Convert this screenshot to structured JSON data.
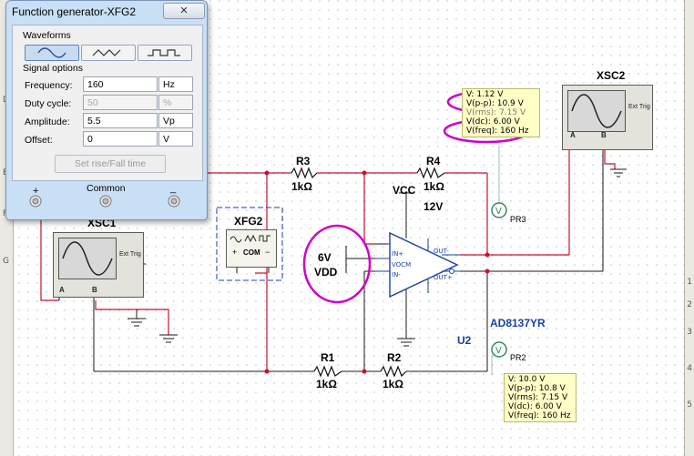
{
  "dialog": {
    "title": "Function generator-XFG2",
    "close_label": "✕",
    "waveforms_label": "Waveforms",
    "waveforms": [
      "sine-wave-icon",
      "triangle-wave-icon",
      "square-wave-icon"
    ],
    "signal_options_label": "Signal options",
    "fields": [
      {
        "label": "Frequency:",
        "value": "160",
        "unit": "Hz",
        "disabled": false
      },
      {
        "label": "Duty cycle:",
        "value": "50",
        "unit": "%",
        "disabled": true
      },
      {
        "label": "Amplitude:",
        "value": "5.5",
        "unit": "Vp",
        "disabled": false
      },
      {
        "label": "Offset:",
        "value": "0",
        "unit": "V",
        "disabled": false
      }
    ],
    "rise_fall_button": "Set rise/Fall time",
    "terminals": {
      "plus": "+",
      "common": "Common",
      "minus": "_"
    }
  },
  "rulers": {
    "left": [
      "D",
      "E",
      "F",
      "G"
    ],
    "right": [
      "1",
      "2",
      "3",
      "4",
      "5"
    ]
  },
  "schematic": {
    "r3": {
      "name": "R3",
      "value": "1kΩ"
    },
    "r4": {
      "name": "R4",
      "value": "1kΩ"
    },
    "r1": {
      "name": "R1",
      "value": "1kΩ"
    },
    "r2": {
      "name": "R2",
      "value": "1kΩ"
    },
    "vcc": {
      "name": "VCC",
      "value": "12V"
    },
    "vdd": {
      "line1": "6V",
      "line2": "VDD"
    },
    "opamp": {
      "part": "AD8137YR",
      "ref": "U2",
      "pins": {
        "inp": "IN+",
        "vocm": "VOCM",
        "inn": "IN-",
        "outm": "OUT-",
        "outp": "OUT+"
      }
    },
    "xfg2": {
      "name": "XFG2",
      "com": "COM",
      "pins": [
        "+",
        "−"
      ]
    },
    "xsc1": {
      "name": "XSC1",
      "ext": "Ext Trig",
      "pins": [
        "A",
        "B"
      ]
    },
    "xsc2": {
      "name": "XSC2",
      "ext": "Ext Trig",
      "pins": [
        "A",
        "B"
      ]
    },
    "probe_pr3": {
      "name": "PR3",
      "lines": [
        "V: 1.12 V",
        "V(p-p): 10.9 V",
        "V(rms): 7.15 V",
        "V(dc): 6.00 V",
        "V(freq): 160 Hz"
      ]
    },
    "probe_pr2": {
      "name": "PR2",
      "lines": [
        "V: 10.0 V",
        "V(p-p): 10.8 V",
        "V(rms): 7.15 V",
        "V(dc): 6.00 V",
        "V(freq): 160 Hz"
      ]
    }
  },
  "colors": {
    "wire_red": "#c8102e",
    "wire_blue": "#1a3fa8",
    "annotation_magenta": "#d000c8",
    "probe_yellow": "#ffffc6",
    "dialog_frame": "#c8dff5"
  }
}
